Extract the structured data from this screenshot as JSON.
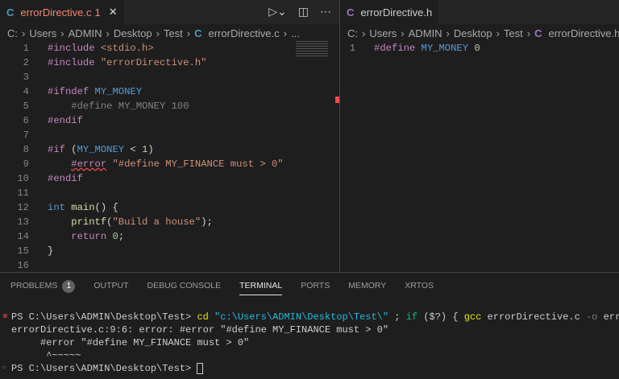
{
  "left_editor": {
    "tab": {
      "icon": "C",
      "name": "errorDirective.c",
      "problems": "1",
      "close": "✕"
    },
    "breadcrumb": [
      "C:",
      "Users",
      "ADMIN",
      "Desktop",
      "Test"
    ],
    "breadcrumb_file_icon": "C",
    "breadcrumb_file": "errorDirective.c",
    "breadcrumb_more": "...",
    "lines": [
      [
        [
          "#include ",
          "#c586c0"
        ],
        [
          "<stdio.h>",
          "#ce9178"
        ]
      ],
      [
        [
          "#include ",
          "#c586c0"
        ],
        [
          "\"errorDirective.h\"",
          "#ce9178"
        ]
      ],
      [],
      [
        [
          "#ifndef ",
          "#c586c0"
        ],
        [
          "MY_MONEY",
          "#569cd6"
        ]
      ],
      [
        [
          "    #define MY_MONEY 100",
          "#808080"
        ]
      ],
      [
        [
          "#endif",
          "#c586c0"
        ]
      ],
      [],
      [
        [
          "#if ",
          "#c586c0"
        ],
        [
          "(",
          "#d4d4d4"
        ],
        [
          "MY_MONEY",
          "#569cd6"
        ],
        [
          " < ",
          "#d4d4d4"
        ],
        [
          "1",
          "#b5cea8"
        ],
        [
          ")",
          "#d4d4d4"
        ]
      ],
      [
        [
          "    ",
          "#d4d4d4"
        ],
        [
          "#error",
          "#c586c0"
        ],
        [
          " ",
          "#d4d4d4"
        ],
        [
          "\"#define MY_FINANCE must > 0\"",
          "#ce9178"
        ]
      ],
      [
        [
          "#endif",
          "#c586c0"
        ]
      ],
      [],
      [
        [
          "int",
          "#569cd6"
        ],
        [
          " ",
          "#d4d4d4"
        ],
        [
          "main",
          "#dcdcaa"
        ],
        [
          "() {",
          "#d4d4d4"
        ]
      ],
      [
        [
          "    ",
          "#d4d4d4"
        ],
        [
          "printf",
          "#dcdcaa"
        ],
        [
          "(",
          "#d4d4d4"
        ],
        [
          "\"Build a house\"",
          "#ce9178"
        ],
        [
          ");",
          "#d4d4d4"
        ]
      ],
      [
        [
          "    ",
          "#d4d4d4"
        ],
        [
          "return",
          "#c586c0"
        ],
        [
          " ",
          "#d4d4d4"
        ],
        [
          "0",
          "#b5cea8"
        ],
        [
          ";",
          "#d4d4d4"
        ]
      ],
      [
        [
          "}",
          "#d4d4d4"
        ]
      ],
      []
    ]
  },
  "right_editor": {
    "tab": {
      "icon": "C",
      "name": "errorDirective.h"
    },
    "breadcrumb": [
      "C:",
      "Users",
      "ADMIN",
      "Desktop",
      "Test"
    ],
    "breadcrumb_file_icon": "C",
    "breadcrumb_file": "errorDirective.h",
    "lines": [
      [
        [
          "#define ",
          "#c586c0"
        ],
        [
          "MY_MONEY",
          "#569cd6"
        ],
        [
          " ",
          "#d4d4d4"
        ],
        [
          "0",
          "#b5cea8"
        ]
      ]
    ]
  },
  "panel": {
    "tabs": [
      "PROBLEMS",
      "OUTPUT",
      "DEBUG CONSOLE",
      "TERMINAL",
      "PORTS",
      "MEMORY",
      "XRTOS"
    ],
    "problems_count": "1",
    "active_tab": "TERMINAL",
    "terminal": [
      {
        "status": "error",
        "parts": [
          [
            "PS C:\\Users\\ADMIN\\Desktop\\Test> ",
            "#cccccc"
          ],
          [
            "cd ",
            "#e5e510"
          ],
          [
            "\"c:\\Users\\ADMIN\\Desktop\\Test\\\"",
            "#29b8db"
          ],
          [
            " ; ",
            "#cccccc"
          ],
          [
            "if ",
            "#0dbc79"
          ],
          [
            "($?) { ",
            "#cccccc"
          ],
          [
            "gcc ",
            "#e5e510"
          ],
          [
            "errorDirective.c ",
            "#cccccc"
          ],
          [
            "-o ",
            "#808080"
          ],
          [
            "erro",
            "#cccccc"
          ]
        ]
      },
      {
        "status": "",
        "parts": [
          [
            "errorDirective.c:9:6: error: #error \"#define MY_FINANCE must > 0\"",
            "#cccccc"
          ]
        ]
      },
      {
        "status": "",
        "parts": [
          [
            "     #error \"#define MY_FINANCE must > 0\"",
            "#cccccc"
          ]
        ]
      },
      {
        "status": "",
        "parts": [
          [
            "      ^~~~~~",
            "#cccccc"
          ]
        ]
      },
      {
        "status": "ok",
        "parts": [
          [
            "PS C:\\Users\\ADMIN\\Desktop\\Test> ",
            "#cccccc"
          ]
        ]
      }
    ]
  }
}
